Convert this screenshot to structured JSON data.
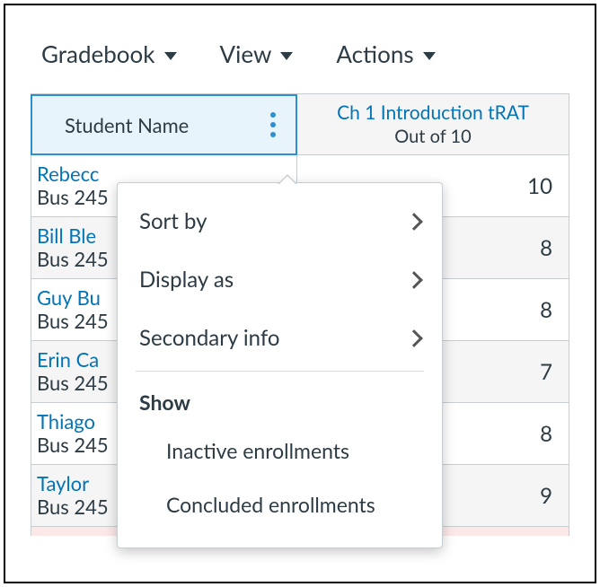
{
  "menubar": {
    "gradebook": "Gradebook",
    "view": "View",
    "actions": "Actions"
  },
  "headers": {
    "student_name": "Student Name",
    "assignment_title": "Ch 1 Introduction tRAT",
    "assignment_sub": "Out of 10"
  },
  "students": [
    {
      "name": "Rebecc",
      "section": "Bus 245",
      "score": "10"
    },
    {
      "name": "Bill Ble",
      "section": "Bus 245",
      "score": "8"
    },
    {
      "name": "Guy Bu",
      "section": "Bus 245",
      "score": "8"
    },
    {
      "name": "Erin Ca",
      "section": "Bus 245",
      "score": "7"
    },
    {
      "name": "Thiago",
      "section": "Bus 245",
      "score": "8"
    },
    {
      "name": "Taylor",
      "section": "Bus 245",
      "score": "9"
    }
  ],
  "dropdown": {
    "sort_by": "Sort by",
    "display_as": "Display as",
    "secondary_info": "Secondary info",
    "show_heading": "Show",
    "inactive": "Inactive enrollments",
    "concluded": "Concluded enrollments"
  }
}
